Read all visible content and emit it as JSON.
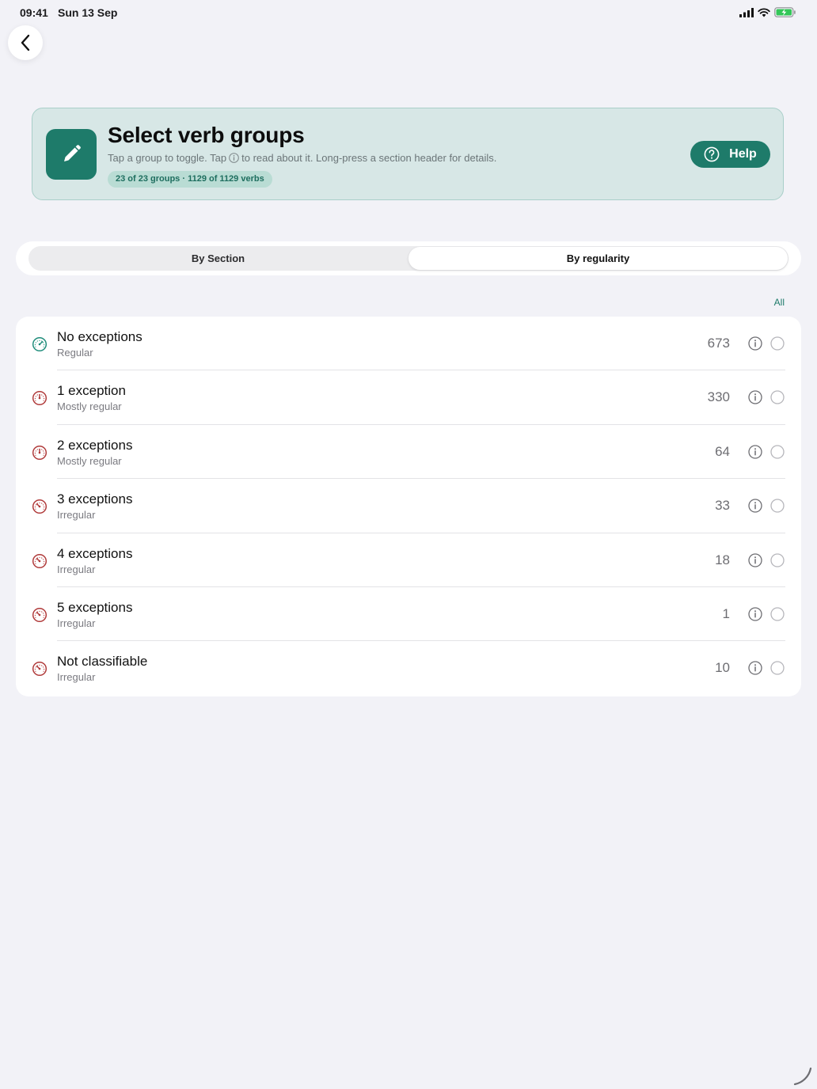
{
  "status": {
    "time": "09:41",
    "date": "Sun 13 Sep"
  },
  "header": {
    "title": "Select verb groups",
    "subtitle_before": "Tap a group to toggle. Tap",
    "subtitle_after": "to read about it. Long-press a section header for details.",
    "badge": "23 of 23 groups · 1129 of 1129 verbs",
    "help_label": "Help"
  },
  "segments": {
    "section": "By Section",
    "regularity": "By regularity",
    "selected": "By regularity"
  },
  "all_label": "All",
  "colors": {
    "accent": "#1e7b6a",
    "regular": "#1e8c7a",
    "irregular": "#b03a3a"
  },
  "rows": [
    {
      "title": "No exceptions",
      "subtitle": "Regular",
      "count": "673",
      "icon": "gauge-regular-icon"
    },
    {
      "title": "1 exception",
      "subtitle": "Mostly regular",
      "count": "330",
      "icon": "gauge-mostly-regular-icon"
    },
    {
      "title": "2 exceptions",
      "subtitle": "Mostly regular",
      "count": "64",
      "icon": "gauge-mostly-regular-icon"
    },
    {
      "title": "3 exceptions",
      "subtitle": "Irregular",
      "count": "33",
      "icon": "gauge-irregular-icon"
    },
    {
      "title": "4 exceptions",
      "subtitle": "Irregular",
      "count": "18",
      "icon": "gauge-irregular-icon"
    },
    {
      "title": "5 exceptions",
      "subtitle": "Irregular",
      "count": "1",
      "icon": "gauge-irregular-icon"
    },
    {
      "title": "Not classifiable",
      "subtitle": "Irregular",
      "count": "10",
      "icon": "gauge-irregular-icon"
    }
  ]
}
